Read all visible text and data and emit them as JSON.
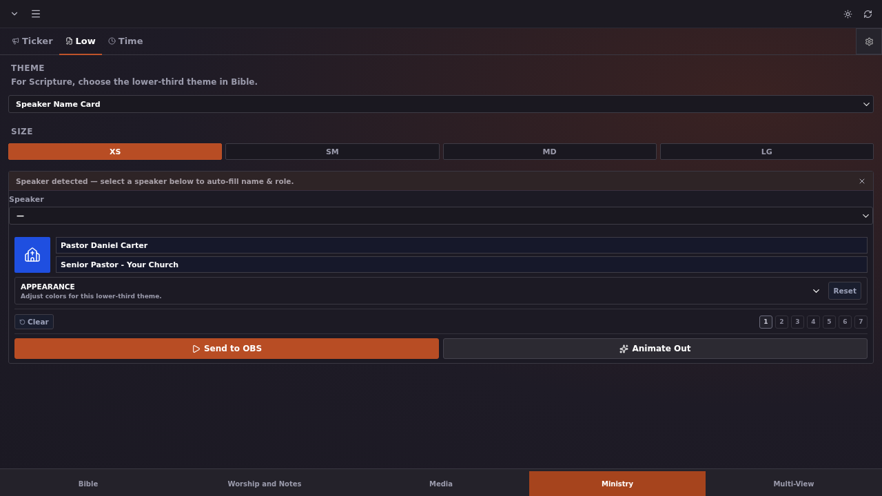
{
  "tabs": [
    {
      "label": "Ticker",
      "selected": false
    },
    {
      "label": "Low",
      "selected": true
    },
    {
      "label": "Time",
      "selected": false
    }
  ],
  "theme": {
    "heading": "THEME",
    "hint": "For Scripture, choose the lower-third theme in Bible.",
    "value": "Speaker Name Card"
  },
  "size": {
    "heading": "SIZE",
    "options": [
      {
        "label": "XS",
        "selected": true
      },
      {
        "label": "SM",
        "selected": false
      },
      {
        "label": "MD",
        "selected": false
      },
      {
        "label": "LG",
        "selected": false
      }
    ]
  },
  "notice": "Speaker detected — select a speaker below to auto-fill name & role.",
  "speaker": {
    "label": "Speaker",
    "value": "—"
  },
  "name": "Pastor Daniel Carter",
  "role": "Senior Pastor - Your Church",
  "appearance": {
    "title": "APPEARANCE",
    "subtitle": "Adjust colors for this lower-third theme.",
    "expanded": false,
    "reset": "Reset"
  },
  "clear": "Clear",
  "pages": [
    {
      "label": "1",
      "selected": true
    },
    {
      "label": "2",
      "selected": false
    },
    {
      "label": "3",
      "selected": false
    },
    {
      "label": "4",
      "selected": false
    },
    {
      "label": "5",
      "selected": false
    },
    {
      "label": "6",
      "selected": false
    },
    {
      "label": "7",
      "selected": false
    }
  ],
  "actions": [
    {
      "label": "Send to OBS",
      "kind": "primary"
    },
    {
      "label": "Animate Out",
      "kind": "secondary"
    }
  ],
  "bottom_tabs": [
    {
      "label": "Bible",
      "selected": false
    },
    {
      "label": "Worship and Notes",
      "selected": false
    },
    {
      "label": "Media",
      "selected": false
    },
    {
      "label": "Ministry",
      "selected": true
    },
    {
      "label": "Multi-View",
      "selected": false
    }
  ]
}
